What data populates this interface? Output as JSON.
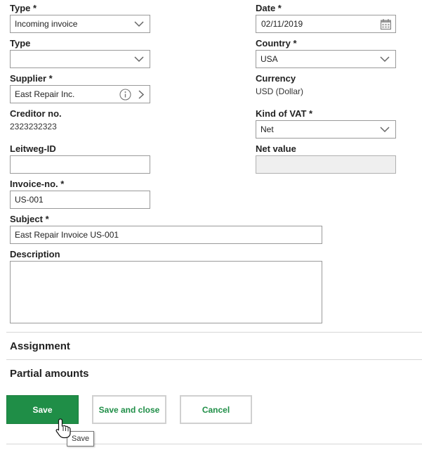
{
  "form": {
    "type1": {
      "label": "Type *",
      "value": "Incoming invoice"
    },
    "type2": {
      "label": "Type",
      "value": ""
    },
    "supplier": {
      "label": "Supplier *",
      "value": "East Repair Inc."
    },
    "creditor": {
      "label": "Creditor no.",
      "value": "2323232323"
    },
    "leitweg": {
      "label": "Leitweg-ID",
      "value": ""
    },
    "invoice_no": {
      "label": "Invoice-no. *",
      "value": "US-001"
    },
    "subject": {
      "label": "Subject *",
      "value": "East Repair Invoice US-001"
    },
    "description": {
      "label": "Description",
      "value": ""
    },
    "date": {
      "label": "Date *",
      "value": "02/11/2019"
    },
    "country": {
      "label": "Country *",
      "value": "USA"
    },
    "currency": {
      "label": "Currency",
      "value": "USD (Dollar)"
    },
    "kind_of_vat": {
      "label": "Kind of VAT *",
      "value": "Net"
    },
    "net_value": {
      "label": "Net value",
      "value": ""
    }
  },
  "sections": {
    "assignment": "Assignment",
    "partial_amounts": "Partial amounts"
  },
  "buttons": {
    "save": "Save",
    "save_close": "Save and close",
    "cancel": "Cancel"
  },
  "tooltip": "Save",
  "colors": {
    "primary": "#1f8e47",
    "border": "#9a9a9a",
    "disabled_bg": "#efefef"
  }
}
